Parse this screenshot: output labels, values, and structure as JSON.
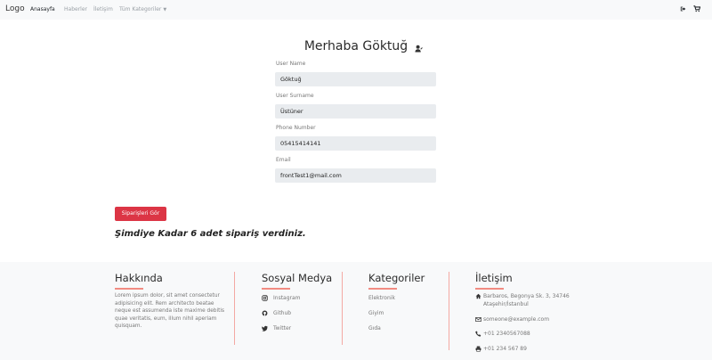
{
  "nav": {
    "logo": "Logo",
    "links": [
      "Anasayfa",
      "Haberler",
      "İletişim",
      "Tüm Kategoriler"
    ],
    "active_index": 0,
    "icons": [
      "sign-out-icon",
      "cart-icon"
    ]
  },
  "profile": {
    "greeting": "Merhaba Göktuğ",
    "fields": [
      {
        "label": "User Name",
        "value": "Göktuğ"
      },
      {
        "label": "User Surname",
        "value": "Üstüner"
      },
      {
        "label": "Phone Number",
        "value": "05415414141"
      },
      {
        "label": "Email",
        "value": "frontTest1@mail.com"
      }
    ],
    "orders_button": "Siparişleri Gör",
    "summary": "Şimdiye Kadar 6 adet sipariş verdiniz."
  },
  "footer": {
    "about": {
      "title": "Hakkında",
      "text": "Lorem ipsum dolor, sit amet consectetur adipisicing elit. Rem architecto beatae neque est assumenda iste maxime debitis quae veritatis, eum, illum nihil aperiam quisquam."
    },
    "social": {
      "title": "Sosyal Medya",
      "items": [
        {
          "icon": "instagram-icon",
          "label": "Instagram"
        },
        {
          "icon": "github-icon",
          "label": "Github"
        },
        {
          "icon": "twitter-icon",
          "label": "Twitter"
        }
      ]
    },
    "categories": {
      "title": "Kategoriler",
      "items": [
        "Elektronik",
        "Giyim",
        "Gıda"
      ]
    },
    "contact": {
      "title": "İletişim",
      "address_line1": "Barbaros, Begonya Sk. 3, 34746",
      "address_line2": "Ataşehir/İstanbul",
      "email": "someone@example.com",
      "phone": "+01 2340567088",
      "fax": "+01 234 567 89"
    }
  },
  "colors": {
    "accent": "#dc3545",
    "underline": "#f28b82",
    "navbar_bg": "#f8f9fa",
    "input_bg": "#e9ecef"
  }
}
